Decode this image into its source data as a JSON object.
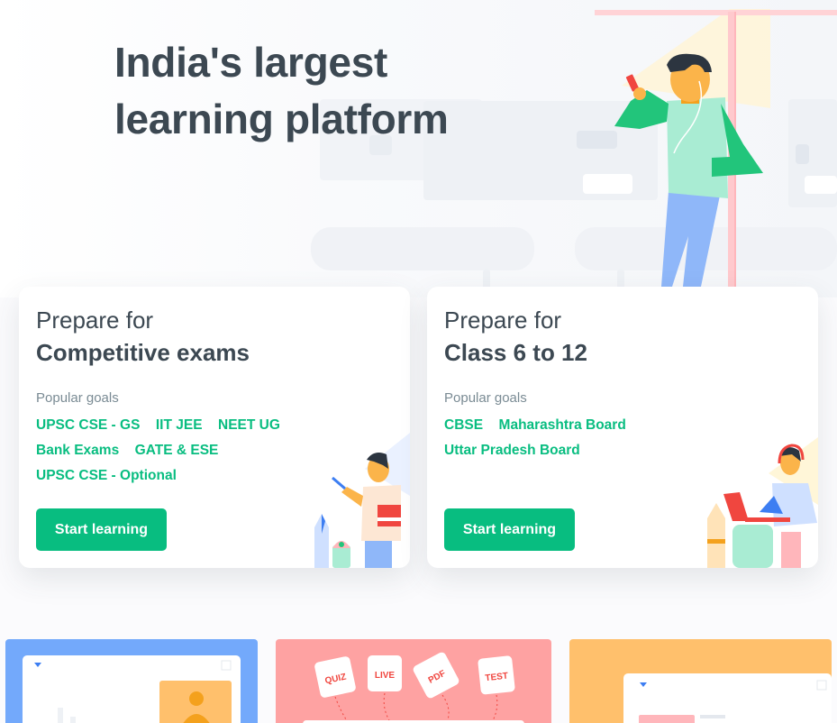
{
  "hero": {
    "title_line1": "India's largest",
    "title_line2": "learning platform"
  },
  "cards": [
    {
      "prep_label": "Prepare for",
      "title": "Competitive exams",
      "popular_label": "Popular goals",
      "goal_rows": [
        [
          "UPSC CSE - GS",
          "IIT JEE",
          "NEET UG"
        ],
        [
          "Bank Exams",
          "GATE & ESE"
        ],
        [
          "UPSC CSE - Optional"
        ]
      ],
      "cta_label": "Start learning"
    },
    {
      "prep_label": "Prepare for",
      "title": "Class 6 to 12",
      "popular_label": "Popular goals",
      "goal_rows": [
        [
          "CBSE",
          "Maharashtra Board"
        ],
        [
          "Uttar Pradesh Board"
        ]
      ],
      "cta_label": "Start learning"
    }
  ],
  "features": {
    "tags": [
      "QUIZ",
      "LIVE",
      "PDF",
      "TEST"
    ]
  },
  "colors": {
    "accent": "#08bd80",
    "text": "#3c4852",
    "muted": "#7a8b94",
    "feature_blue": "#73a9fb",
    "feature_pink": "#fea2a2",
    "feature_orange": "#ffc06c"
  }
}
